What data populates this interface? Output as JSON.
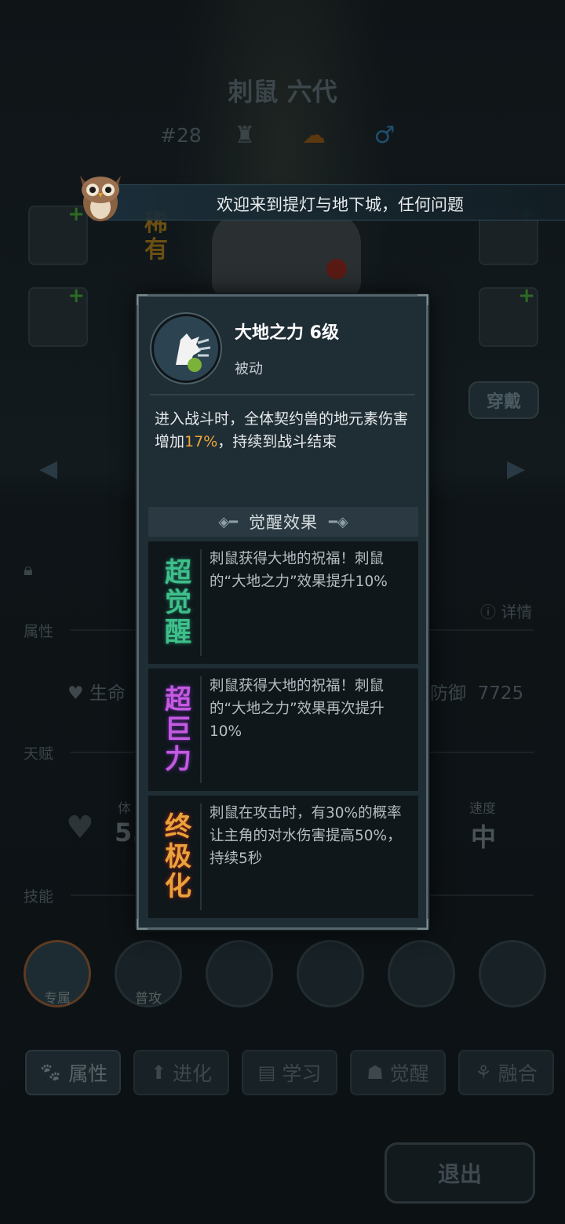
{
  "pet": {
    "name": "刺鼠 六代",
    "rank": "#28",
    "rarity": "稀有"
  },
  "banner": {
    "text": "欢迎来到提灯与地下城，任何问题"
  },
  "equip": {
    "wear_label": "穿戴"
  },
  "stats": {
    "section_attr": "属性",
    "detail_label": "详情",
    "hp_label": "生命",
    "def_label": "防御",
    "def_value": "7725",
    "section_talent": "天赋",
    "body_label": "体",
    "body_value": "5.",
    "speed_label": "速度",
    "speed_value": "中",
    "section_skill": "技能"
  },
  "skills_bar": {
    "slot1_tag": "专属",
    "slot2_tag": "普攻"
  },
  "tabs": [
    {
      "label": "属性",
      "icon": "paw-icon"
    },
    {
      "label": "进化",
      "icon": "arrow-up-icon"
    },
    {
      "label": "学习",
      "icon": "book-icon"
    },
    {
      "label": "觉醒",
      "icon": "beast-face-icon"
    },
    {
      "label": "融合",
      "icon": "fusion-icon"
    }
  ],
  "exit_label": "退出",
  "popup": {
    "title": "大地之力 6级",
    "type": "被动",
    "desc_pre": "进入战斗时，全体契约兽的地元素伤害增加",
    "desc_highlight": "17%",
    "desc_post": "，持续到战斗结束",
    "awaken_header": "觉醒效果",
    "awakenings": [
      {
        "badge": [
          "超",
          "觉",
          "醒"
        ],
        "color": "#3fbf8a",
        "glow": "#1e6b55",
        "text": "刺鼠获得大地的祝福！刺鼠的“大地之力”效果提升10%"
      },
      {
        "badge": [
          "超",
          "巨",
          "力"
        ],
        "color": "#c45ae0",
        "glow": "#5a2a8a",
        "text": "刺鼠获得大地的祝福！刺鼠的“大地之力”效果再次提升10%"
      },
      {
        "badge": [
          "终",
          "极",
          "化"
        ],
        "color": "#e8a43a",
        "glow": "#8a2418",
        "text": "刺鼠在攻击时，有30%的概率让主角的对水伤害提高50%，持续5秒"
      }
    ]
  },
  "colors": {
    "highlight": "#f0a83a",
    "popup_bg": "#1f2d34",
    "popup_border": "#56656c"
  }
}
